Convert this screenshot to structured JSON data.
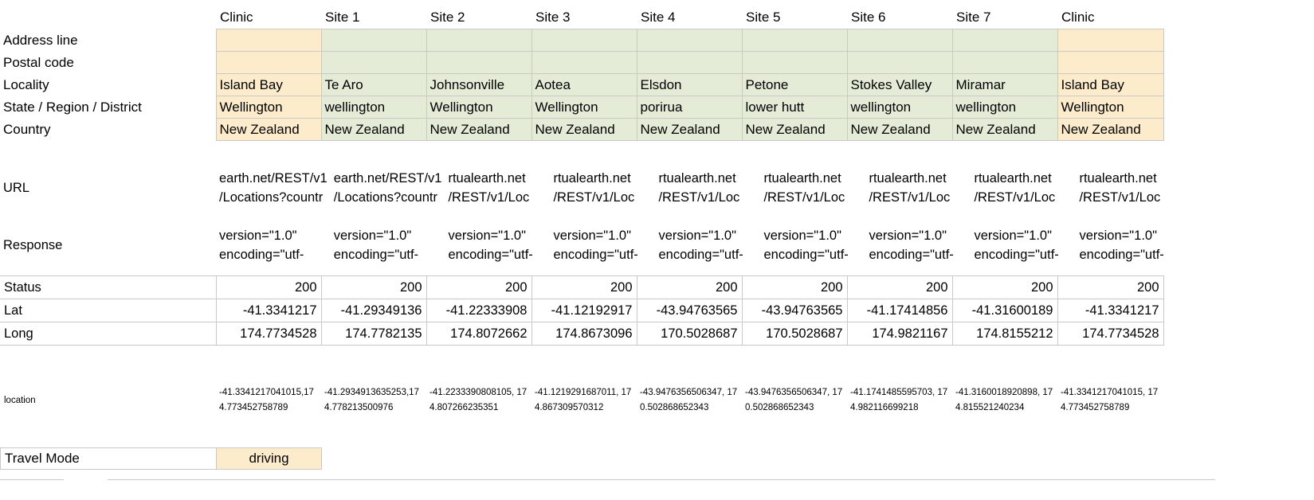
{
  "columns": [
    {
      "header": "Clinic",
      "type": "clinic"
    },
    {
      "header": "Site 1",
      "type": "site"
    },
    {
      "header": "Site 2",
      "type": "site"
    },
    {
      "header": "Site 3",
      "type": "site"
    },
    {
      "header": "Site 4",
      "type": "site"
    },
    {
      "header": "Site 5",
      "type": "site"
    },
    {
      "header": "Site 6",
      "type": "site"
    },
    {
      "header": "Site 7",
      "type": "site"
    },
    {
      "header": "Clinic",
      "type": "clinic"
    }
  ],
  "row_labels": {
    "address_line": "Address line",
    "postal_code": "Postal code",
    "locality": "Locality",
    "state_region_district": "State / Region / District",
    "country": "Country",
    "url": "URL",
    "response": "Response",
    "status": "Status",
    "lat": "Lat",
    "long": "Long",
    "location": "location",
    "travel_mode": "Travel Mode"
  },
  "rows": {
    "address_line": [
      "",
      "",
      "",
      "",
      "",
      "",
      "",
      "",
      ""
    ],
    "postal_code": [
      "",
      "",
      "",
      "",
      "",
      "",
      "",
      "",
      ""
    ],
    "locality": [
      "Island Bay",
      "Te Aro",
      "Johnsonville",
      "Aotea",
      "Elsdon",
      "Petone",
      "Stokes Valley",
      "Miramar",
      "Island Bay"
    ],
    "state_region_district": [
      "Wellington",
      "wellington",
      "Wellington",
      "Wellington",
      "porirua",
      "lower hutt",
      "wellington",
      "wellington",
      "Wellington"
    ],
    "country": [
      "New Zealand",
      "New Zealand",
      "New Zealand",
      "New Zealand",
      "New Zealand",
      "New Zealand",
      "New Zealand",
      "New Zealand",
      "New Zealand"
    ],
    "url": [
      [
        "earth.net/REST/v1",
        "/Locations?countr"
      ],
      [
        "earth.net/REST/v1",
        "/Locations?countr"
      ],
      [
        "rtualearth.net",
        "/REST/v1/Loc"
      ],
      [
        "rtualearth.net",
        "/REST/v1/Loc"
      ],
      [
        "rtualearth.net",
        "/REST/v1/Loc"
      ],
      [
        "rtualearth.net",
        "/REST/v1/Loc"
      ],
      [
        "rtualearth.net",
        "/REST/v1/Loc"
      ],
      [
        "rtualearth.net",
        "/REST/v1/Loc"
      ],
      [
        "rtualearth.net",
        "/REST/v1/Loc"
      ]
    ],
    "response": [
      [
        "version=\"1.0\"",
        "encoding=\"utf-"
      ],
      [
        "version=\"1.0\"",
        "encoding=\"utf-"
      ],
      [
        "version=\"1.0\"",
        "encoding=\"utf-"
      ],
      [
        "version=\"1.0\"",
        "encoding=\"utf-"
      ],
      [
        "version=\"1.0\"",
        "encoding=\"utf-"
      ],
      [
        "version=\"1.0\"",
        "encoding=\"utf-"
      ],
      [
        "version=\"1.0\"",
        "encoding=\"utf-"
      ],
      [
        "version=\"1.0\"",
        "encoding=\"utf-"
      ],
      [
        "version=\"1.0\"",
        "encoding=\"utf-"
      ]
    ],
    "status": [
      "200",
      "200",
      "200",
      "200",
      "200",
      "200",
      "200",
      "200",
      "200"
    ],
    "lat": [
      "-41.3341217",
      "-41.29349136",
      "-41.22333908",
      "-41.12192917",
      "-43.94763565",
      "-43.94763565",
      "-41.17414856",
      "-41.31600189",
      "-41.3341217"
    ],
    "long": [
      "174.7734528",
      "174.7782135",
      "174.8072662",
      "174.8673096",
      "170.5028687",
      "170.5028687",
      "174.9821167",
      "174.8155212",
      "174.7734528"
    ],
    "location": [
      "-41.3341217041015,174.773452758789",
      "-41.2934913635253,174.778213500976",
      "-41.2233390808105, 174.807266235351",
      "-41.1219291687011, 174.867309570312",
      "-43.9476356506347, 170.502868652343",
      "-43.9476356506347, 170.502868652343",
      "-41.1741485595703, 174.982116699218",
      "-41.3160018920898, 174.815521240234",
      "-41.3341217041015, 174.773452758789"
    ]
  },
  "travel_mode_value": "driving",
  "colors": {
    "clinic_fill": "#fdeccb",
    "site_fill": "#e4ecd7",
    "gridline": "#c9c9c9",
    "text": "#000000",
    "background": "#ffffff"
  }
}
